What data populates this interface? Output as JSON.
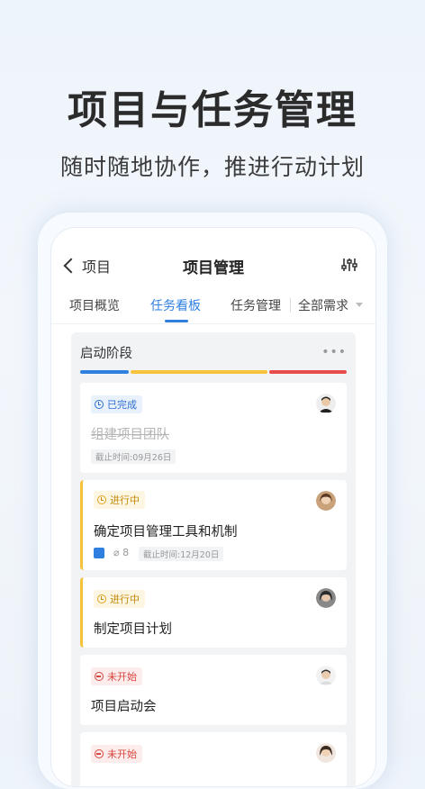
{
  "headline": "项目与任务管理",
  "subline": "随时随地协作，推进行动计划",
  "nav": {
    "back_label": "项目",
    "title": "项目管理"
  },
  "tabs": [
    "项目概览",
    "任务看板",
    "任务管理",
    "全部需求"
  ],
  "active_tab": 1,
  "board": {
    "stage_title": "启动阶段",
    "more": "•••",
    "progress_colors": [
      "#2f7fe0",
      "#f5c23c",
      "#e84c4c"
    ],
    "cards": [
      {
        "status": "已完成",
        "title": "组建项目团队",
        "deadline": "截止时间:09月26日"
      },
      {
        "status": "进行中",
        "title": "确定项目管理工具和机制",
        "attachments": "8",
        "deadline": "截止时间:12月20日"
      },
      {
        "status": "进行中",
        "title": "制定项目计划"
      },
      {
        "status": "未开始",
        "title": "项目启动会"
      },
      {
        "status": "未开始"
      }
    ]
  },
  "colors": {
    "accent": "#2f7fe0",
    "in_progress": "#f5c23c",
    "not_started": "#d6453d"
  }
}
